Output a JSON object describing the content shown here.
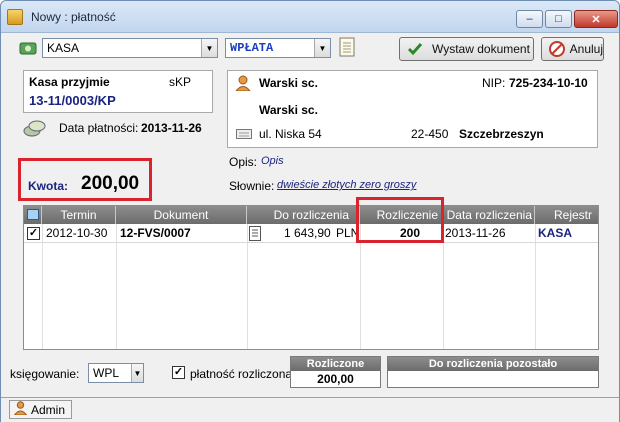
{
  "window": {
    "title": "Nowy : płatność",
    "min": "–",
    "max": "□",
    "close": "✕"
  },
  "toolbar": {
    "cash_register": "KASA",
    "operation": "WPŁATA",
    "issue_document": "Wystaw dokument",
    "cancel": "Anuluj"
  },
  "receipt": {
    "register_receives": "Kasa przyjmie",
    "doc_type": "sKP",
    "doc_number": "13-11/0003/KP",
    "payment_date_label": "Data płatności:",
    "payment_date": "2013-11-26"
  },
  "amount": {
    "label": "Kwota:",
    "value": "200,00"
  },
  "contractor": {
    "name": "Warski sc.",
    "nip_label": "NIP:",
    "nip": "725-234-10-10",
    "full_name": "Warski sc.",
    "street": "ul. Niska 54",
    "postal_code": "22-450",
    "city": "Szczebrzeszyn"
  },
  "description": {
    "label": "Opis:",
    "value": "Opis",
    "words_label": "Słownie:",
    "words": "dwieście złotych zero groszy"
  },
  "grid": {
    "columns": [
      "Termin",
      "Dokument",
      "Do rozliczenia",
      "Rozliczenie",
      "Data rozliczenia",
      "Rejestr"
    ],
    "rows": [
      {
        "checked": "✓",
        "term": "2012-10-30",
        "document": "12-FVS/0007",
        "due": "1 643,90",
        "currency": "PLN",
        "settled": "200",
        "settle_date": "2013-11-26",
        "register": "KASA"
      }
    ]
  },
  "footer": {
    "posting_label": "księgowanie:",
    "posting_value": "WPL",
    "payment_settled_label": "płatność rozliczona",
    "payment_settled_checked": "✓",
    "settled_header": "Rozliczone",
    "settled_value": "200,00",
    "remaining_header": "Do rozliczenia pozostało",
    "remaining_value": ""
  },
  "status": {
    "user": "Admin"
  },
  "colors": {
    "highlight": "#d9232d",
    "header_gray": "#7a7a7a",
    "accent_blue": "#1a237e"
  },
  "icons": [
    "cash-icon",
    "notepad-icon",
    "check-icon",
    "cancel-icon",
    "person-icon",
    "keyboard-icon",
    "coins-icon"
  ]
}
